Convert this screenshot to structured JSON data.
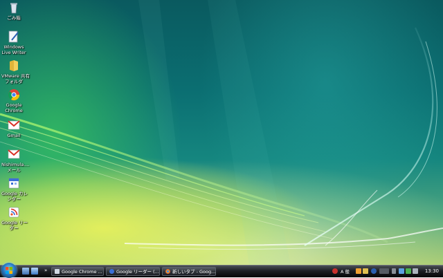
{
  "desktop": {
    "icons": [
      {
        "label1": "ごみ箱",
        "label2": "",
        "icon": "recycle-bin-icon"
      },
      {
        "label1": "Windows",
        "label2": "Live Writer",
        "icon": "live-writer-icon"
      },
      {
        "label1": "VMware 共有",
        "label2": "フォルダ",
        "icon": "shared-folder-icon"
      },
      {
        "label1": "Google",
        "label2": "Chrome",
        "icon": "chrome-icon"
      },
      {
        "label1": "Gmail",
        "label2": "",
        "icon": "gmail-icon"
      },
      {
        "label1": "Nishimula....",
        "label2": "メール",
        "icon": "gmail-icon"
      },
      {
        "label1": "Google カレ",
        "label2": "ンダー",
        "icon": "google-calendar-icon"
      },
      {
        "label1": "Google リー",
        "label2": "ダー",
        "icon": "google-reader-icon"
      }
    ]
  },
  "taskbar": {
    "chevron": "»",
    "buttons": [
      {
        "label": "Google Chrome ...",
        "icon": "window-icon"
      },
      {
        "label": "Google リーダー (...",
        "icon": "google-reader-icon"
      },
      {
        "label": "新しいタブ - Goog...",
        "icon": "chrome-icon"
      }
    ],
    "tray": {
      "ime": "A 般",
      "clock": "13:30"
    }
  },
  "colors": {
    "taskbar": "#1c1f24",
    "desktop_teal": "#0b6f72",
    "desktop_yellow": "#e6f05a"
  }
}
